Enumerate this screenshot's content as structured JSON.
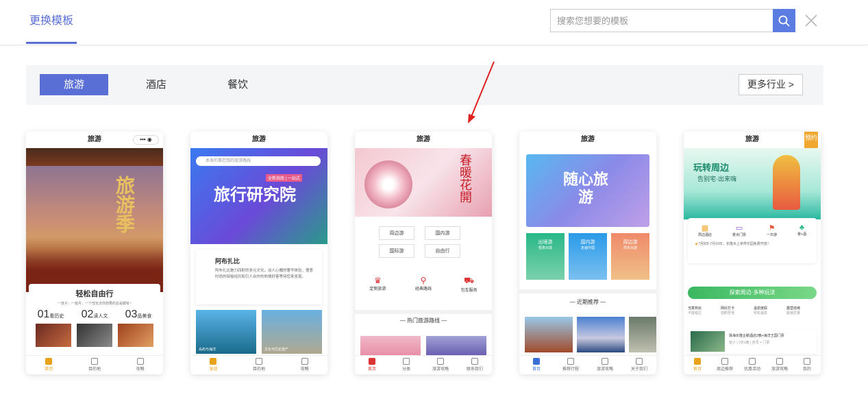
{
  "header": {
    "tab_title": "更换模板",
    "search_placeholder": "搜索您想要的模板"
  },
  "categories": {
    "items": [
      "旅游",
      "酒店",
      "餐饮"
    ],
    "more_label": "更多行业 >"
  },
  "cards": [
    {
      "title": "旅游",
      "banner_text": "旅游季",
      "section_title": "轻松自由行",
      "subtitle": "一放子，一窗月，一个性玩法你想要的总是都有~",
      "stats": [
        {
          "num": "01",
          "label": "看历史"
        },
        {
          "num": "02",
          "label": "读人文"
        },
        {
          "num": "03",
          "label": "品美食"
        }
      ],
      "nav": [
        "首页",
        "目的地",
        "攻略"
      ]
    },
    {
      "title": "旅游",
      "search_hint": "本身的事您想的旅游路线",
      "banner_text": "旅行研究院",
      "banner_tag": "全新指南 | 一站式",
      "article_title": "阿布扎比",
      "article_body": "阿布扎比魅力四射的多元文化，动人心魄的奢华体验，惬意时尚的探秘经历和引人合作的热情好客等待您来发现。",
      "photos": [
        "岛屿与海洋",
        "文化与历史遗产"
      ],
      "nav": [
        "发现",
        "目的地",
        "攻略"
      ]
    },
    {
      "title": "旅游",
      "banner_text": "春暖花開",
      "tags": [
        "周边游",
        "国内游",
        "国际游",
        "自由行"
      ],
      "services": [
        "定制旅游",
        "经典路线",
        "包车服务"
      ],
      "section_title": "热门旅游路线",
      "nav": [
        "首页",
        "分类",
        "旅游攻略",
        "联系我们"
      ]
    },
    {
      "title": "旅游",
      "banner_text": "随心旅游",
      "tiles": [
        {
          "name": "出境游",
          "sub": "惬意出境"
        },
        {
          "name": "国内游",
          "sub": "走遍中国"
        },
        {
          "name": "周边游",
          "sub": "周末出游"
        }
      ],
      "section_title": "近期推荐",
      "nav": [
        "首页",
        "推荐行程",
        "旅游攻略",
        "关于我们"
      ]
    },
    {
      "title": "旅游",
      "badge": "预约",
      "banner_text": "玩转周边",
      "banner_sub": "告别宅·出来嗨",
      "icons": [
        "周边酒店",
        "景点门票",
        "一日游",
        "景+酒"
      ],
      "notice": "7月8日-7月10日，长隆水上世界乐园免费开放！",
      "section_title": "探索周边·多种玩法",
      "grid": [
        "当季热玩",
        "网红打卡",
        "温泉度假",
        "露营烧烤"
      ],
      "grid_sub": [
        "不能错过",
        "拍照圣地",
        "轻松温泉",
        "超值优惠"
      ],
      "listing": "珠海长隆企鹅酒店2晚+海洋王国门票",
      "listing_sub": "双人 | 2天1晚 | 含早 + 门票",
      "nav": [
        "首页",
        "周边推荐",
        "优惠活动",
        "旅游攻略",
        "我的"
      ]
    }
  ],
  "colors": {
    "accent": "#5a6fd6",
    "search_button": "#5b7ce0",
    "arrow": "#e02020"
  }
}
